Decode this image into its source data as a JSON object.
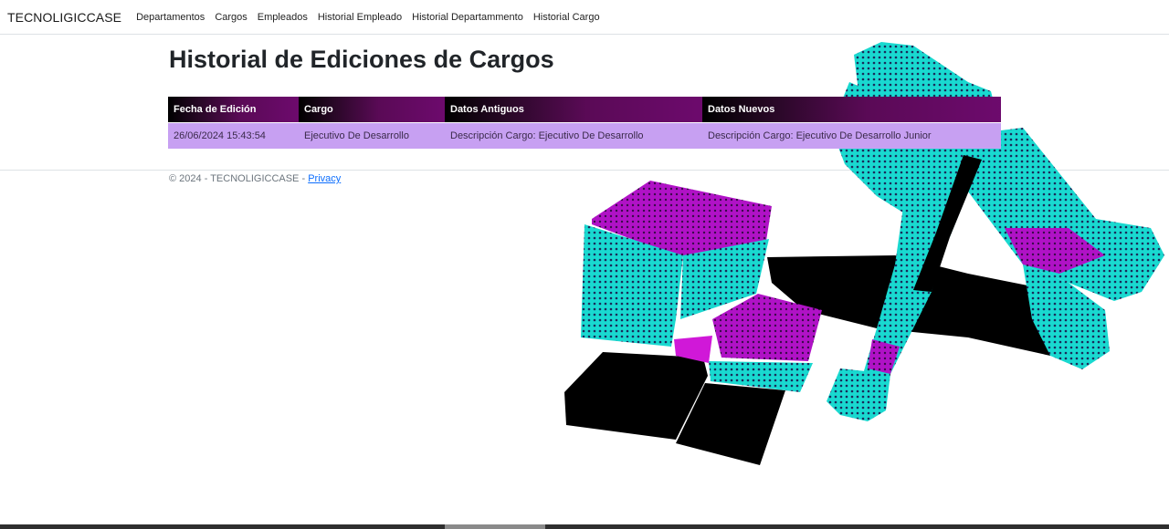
{
  "navbar": {
    "brand": "TECNOLIGICCASE",
    "links": [
      "Departamentos",
      "Cargos",
      "Empleados",
      "Historial Empleado",
      "Historial Departammento",
      "Historial Cargo"
    ]
  },
  "page": {
    "title": "Historial de Ediciones de Cargos"
  },
  "table": {
    "headers": [
      "Fecha de Edición",
      "Cargo",
      "Datos Antiguos",
      "Datos Nuevos"
    ],
    "rows": [
      [
        "26/06/2024 15:43:54",
        "Ejecutivo De Desarrollo",
        "Descripción Cargo: Ejecutivo De Desarrollo",
        "Descripción Cargo: Ejecutivo De Desarrollo Junior"
      ]
    ]
  },
  "footer": {
    "copyright": "© 2024 - TECNOLIGICCASE -",
    "privacy_link": "Privacy"
  },
  "colors": {
    "header_start": "#000000",
    "header_end": "#6d0a6d",
    "row_bg": "#c7a0f2",
    "art_cyan": "#1ff2e3",
    "art_magenta": "#b012c6"
  }
}
